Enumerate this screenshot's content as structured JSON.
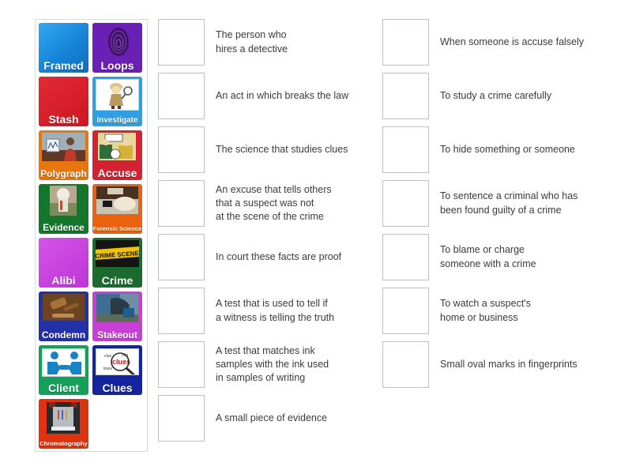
{
  "activity": {
    "type": "match-up",
    "tile_panel_label": "word-tiles"
  },
  "tiles": [
    {
      "label": "Framed",
      "label_size": "lbl-lg",
      "bg": "#1f8fe0",
      "art": "gradient-blue"
    },
    {
      "label": "Loops",
      "label_size": "lbl-lg",
      "bg": "#6a1fb5",
      "art": "fingerprint-image"
    },
    {
      "label": "Stash",
      "label_size": "lbl-lg",
      "bg": "#d81f2a",
      "art": "solid-red"
    },
    {
      "label": "Investigate",
      "label_size": "lbl-sm",
      "bg": "#2e9fe0",
      "art": "detective-cartoon-image"
    },
    {
      "label": "Polygraph",
      "label_size": "lbl-md",
      "bg": "#e8760f",
      "art": "polygraph-machine-photo"
    },
    {
      "label": "Accuse",
      "label_size": "lbl-lg",
      "bg": "#d42233",
      "art": "courtroom-cartoon-image"
    },
    {
      "label": "Evidence",
      "label_size": "lbl-md",
      "bg": "#13762b",
      "art": "evidence-photo"
    },
    {
      "label": "Forensic\nScience",
      "label_size": "lbl-xs",
      "bg": "#e8620f",
      "art": "forensic-lab-photo"
    },
    {
      "label": "Alibi",
      "label_size": "lbl-lg",
      "bg": "#c83fe0",
      "art": "solid-magenta"
    },
    {
      "label": "Crime",
      "label_size": "lbl-lg",
      "bg": "#1b6b2e",
      "art": "crime-scene-tape-image"
    },
    {
      "label": "Condemn",
      "label_size": "lbl-md",
      "bg": "#2231a8",
      "art": "gavel-photo"
    },
    {
      "label": "Stakeout",
      "label_size": "lbl-md",
      "bg": "#c83fd6",
      "art": "stakeout-car-photo"
    },
    {
      "label": "Client",
      "label_size": "lbl-lg",
      "bg": "#14a05a",
      "art": "handshake-icon-image"
    },
    {
      "label": "Clues",
      "label_size": "lbl-lg",
      "bg": "#14249e",
      "art": "magnifier-clues-image"
    },
    {
      "label": "Chromatography",
      "label_size": "lbl-xs",
      "bg": "#e0320f",
      "art": "chromatography-apparatus-photo"
    }
  ],
  "middle_column": [
    {
      "text": "The person who\nhires a detective"
    },
    {
      "text": "An act in which breaks the law"
    },
    {
      "text": "The science that studies clues"
    },
    {
      "text": "An excuse that tells others\nthat a suspect was not\nat the scene of the crime"
    },
    {
      "text": "In court these facts are proof"
    },
    {
      "text": "A test that is used to tell if\na witness is telling the truth"
    },
    {
      "text": "A test that matches ink\nsamples with the ink used\nin samples of writing"
    },
    {
      "text": "A small piece of evidence"
    }
  ],
  "right_column": [
    {
      "text": "When someone is accuse falsely"
    },
    {
      "text": "To study a crime carefully"
    },
    {
      "text": "To hide something or someone"
    },
    {
      "text": "To sentence a criminal who has\nbeen found guilty of a crime"
    },
    {
      "text": "To blame or charge\nsomeone with a crime"
    },
    {
      "text": "To watch a suspect's\nhome or business"
    },
    {
      "text": "Small oval marks in fingerprints"
    }
  ],
  "colors": {
    "panel_border": "#d9d9d9",
    "box_border": "#bfbfbf",
    "text": "#3b3b3b",
    "background": "#ffffff"
  }
}
